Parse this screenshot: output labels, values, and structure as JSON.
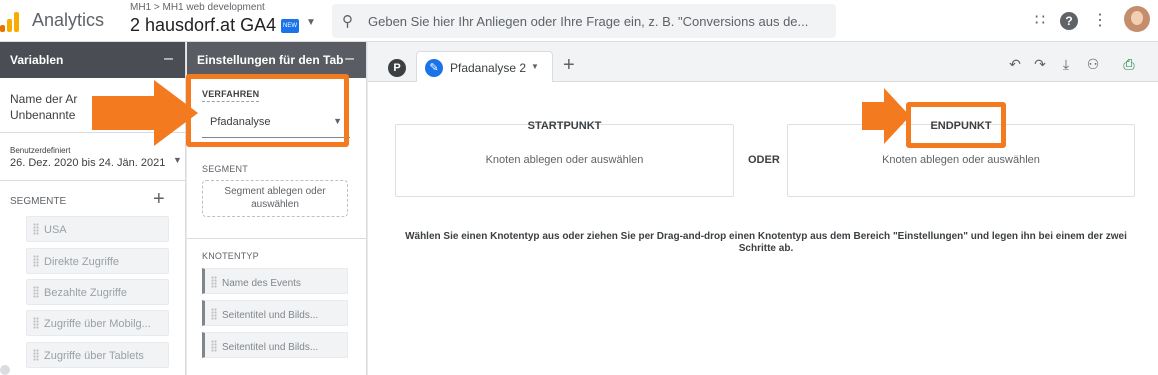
{
  "header": {
    "app_name": "Analytics",
    "breadcrumb": "MH1 > MH1 web development",
    "property": "2 hausdorf.at GA4",
    "new_badge": "NEW",
    "search_placeholder": "Geben Sie hier Ihr Anliegen oder Ihre Frage ein, z. B. \"Conversions aus de..."
  },
  "variables": {
    "title": "Variablen",
    "name_label": "Name der Ar",
    "name_value": "Unbenannte",
    "date_label": "Benutzerdefiniert",
    "date_value": "26. Dez. 2020 bis 24. Jän. 2021",
    "segments_header": "SEGMENTE",
    "segments": [
      "USA",
      "Direkte Zugriffe",
      "Bezahlte Zugriffe",
      "Zugriffe über Mobilg...",
      "Zugriffe über Tablets"
    ]
  },
  "settings": {
    "title": "Einstellungen für den Tab",
    "technique_label": "VERFAHREN",
    "technique_value": "Pfadanalyse",
    "segment_header": "SEGMENT",
    "segment_drop": "Segment ablegen oder auswählen",
    "node_type_header": "KNOTENTYP",
    "node_types": [
      "Name des Events",
      "Seitentitel und Bilds...",
      "Seitentitel und Bilds..."
    ]
  },
  "canvas": {
    "user_initial": "P",
    "tab_label": "Pfadanalyse 2",
    "start_title": "STARTPUNKT",
    "start_hint": "Knoten ablegen oder auswählen",
    "or_label": "ODER",
    "end_title": "ENDPUNKT",
    "end_hint": "Knoten ablegen oder auswählen",
    "instruction": "Wählen Sie einen Knotentyp aus oder ziehen Sie per Drag-and-drop einen Knotentyp aus dem Bereich \"Einstellungen\" und legen ihn bei einem der zwei Schritte ab."
  },
  "colors": {
    "highlight": "#f47a20",
    "header_dark": "#4a4e54",
    "accent": "#1a73e8"
  },
  "icons": [
    "analytics-logo-icon",
    "search-icon",
    "apps-icon",
    "help-icon",
    "more-vert-icon",
    "undo-icon",
    "redo-icon",
    "download-icon",
    "share-icon",
    "export-icon",
    "pencil-icon",
    "add-icon",
    "remove-icon"
  ]
}
